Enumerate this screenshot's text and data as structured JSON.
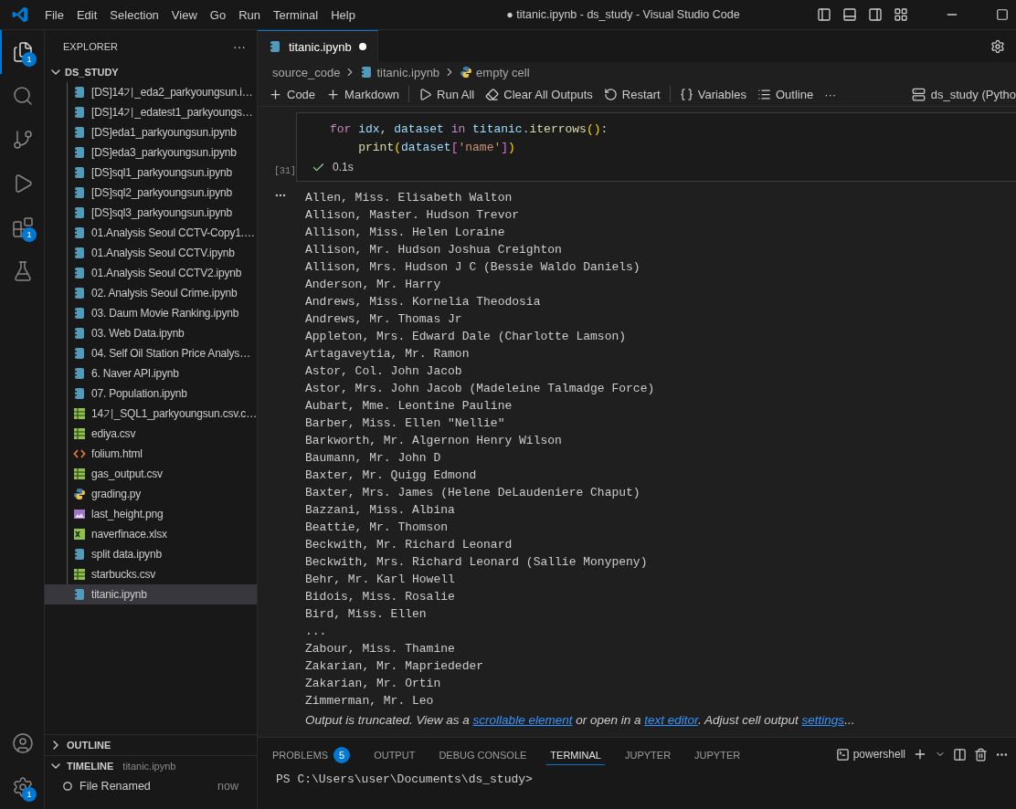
{
  "title_bar": {
    "menus": [
      "File",
      "Edit",
      "Selection",
      "View",
      "Go",
      "Run",
      "Terminal",
      "Help"
    ],
    "title": "● titanic.ipynb - ds_study - Visual Studio Code"
  },
  "activity_bar": {
    "items": [
      {
        "kind": "files",
        "selected": true,
        "badge": "1"
      },
      {
        "kind": "search",
        "selected": false
      },
      {
        "kind": "source-control",
        "selected": false
      },
      {
        "kind": "run",
        "selected": false
      },
      {
        "kind": "extensions",
        "selected": false,
        "badge": "1"
      },
      {
        "kind": "testing",
        "selected": false
      }
    ],
    "bottom": [
      {
        "kind": "account"
      },
      {
        "kind": "manage",
        "badge": "1"
      }
    ]
  },
  "sidebar": {
    "title": "EXPLORER",
    "more": "···",
    "folder": {
      "name": "DS_STUDY",
      "expanded": true
    },
    "files": [
      {
        "name": "[DS]14기_eda2_parkyoungsun.i…",
        "kind": "notebook",
        "selected": false
      },
      {
        "name": "[DS]14기_edatest1_parkyoungs…",
        "kind": "notebook",
        "selected": false
      },
      {
        "name": "[DS]eda1_parkyoungsun.ipynb",
        "kind": "notebook",
        "selected": false
      },
      {
        "name": "[DS]eda3_parkyoungsun.ipynb",
        "kind": "notebook",
        "selected": false
      },
      {
        "name": "[DS]sql1_parkyoungsun.ipynb",
        "kind": "notebook",
        "selected": false
      },
      {
        "name": "[DS]sql2_parkyoungsun.ipynb",
        "kind": "notebook",
        "selected": false
      },
      {
        "name": "[DS]sql3_parkyoungsun.ipynb",
        "kind": "notebook",
        "selected": false
      },
      {
        "name": "01.Analysis Seoul CCTV-Copy1.…",
        "kind": "notebook",
        "selected": false
      },
      {
        "name": "01.Analysis Seoul CCTV.ipynb",
        "kind": "notebook",
        "selected": false
      },
      {
        "name": "01.Analysis Seoul CCTV2.ipynb",
        "kind": "notebook",
        "selected": false
      },
      {
        "name": "02. Analysis Seoul Crime.ipynb",
        "kind": "notebook",
        "selected": false
      },
      {
        "name": "03. Daum Movie Ranking.ipynb",
        "kind": "notebook",
        "selected": false
      },
      {
        "name": "03. Web Data.ipynb",
        "kind": "notebook",
        "selected": false
      },
      {
        "name": "04. Self Oil Station Price Analys…",
        "kind": "notebook",
        "selected": false
      },
      {
        "name": "6. Naver API.ipynb",
        "kind": "notebook",
        "selected": false
      },
      {
        "name": "07. Population.ipynb",
        "kind": "notebook",
        "selected": false
      },
      {
        "name": "14기_SQL1_parkyoungsun.csv.c…",
        "kind": "csv",
        "selected": false
      },
      {
        "name": "ediya.csv",
        "kind": "csv",
        "selected": false
      },
      {
        "name": "folium.html",
        "kind": "html",
        "selected": false
      },
      {
        "name": "gas_output.csv",
        "kind": "csv",
        "selected": false
      },
      {
        "name": "grading.py",
        "kind": "python",
        "selected": false
      },
      {
        "name": "last_height.png",
        "kind": "image",
        "selected": false
      },
      {
        "name": "naverfinace.xlsx",
        "kind": "excel",
        "selected": false
      },
      {
        "name": "split data.ipynb",
        "kind": "notebook",
        "selected": false
      },
      {
        "name": "starbucks.csv",
        "kind": "csv",
        "selected": false
      },
      {
        "name": "titanic.ipynb",
        "kind": "notebook",
        "selected": true
      }
    ],
    "sections": [
      {
        "title": "OUTLINE",
        "expanded": false
      },
      {
        "title": "TIMELINE",
        "subtitle": "titanic.ipynb",
        "expanded": true,
        "entries": [
          {
            "label": "File Renamed",
            "time": "now"
          }
        ]
      }
    ]
  },
  "editor": {
    "tabs": [
      {
        "label": "titanic.ipynb",
        "modified": true,
        "selected": true
      }
    ],
    "breadcrumb": [
      {
        "label": "source_code",
        "kind": "folder"
      },
      {
        "label": "titanic.ipynb",
        "kind": "notebook"
      },
      {
        "label": "empty cell",
        "kind": "python"
      }
    ],
    "toolbar": [
      {
        "label": "Code",
        "kind": "plus"
      },
      {
        "label": "Markdown",
        "kind": "plus"
      },
      {
        "label": "Run All",
        "kind": "run"
      },
      {
        "label": "Clear All Outputs",
        "kind": "clear"
      },
      {
        "label": "Restart",
        "kind": "restart"
      },
      {
        "label": "Variables",
        "kind": "variables"
      },
      {
        "label": "Outline",
        "kind": "outline"
      },
      {
        "label": "···",
        "kind": "more"
      }
    ],
    "kernel": "ds_study (Pytho",
    "cell": {
      "execution_count": "[31]",
      "succeeded": true,
      "duration": "0.1s",
      "code": [
        [
          {
            "text": "for ",
            "kind": "keyword"
          },
          {
            "text": "idx",
            "kind": "variable"
          },
          {
            "text": ", ",
            "kind": "plain"
          },
          {
            "text": "dataset ",
            "kind": "variable"
          },
          {
            "text": "in ",
            "kind": "keyword"
          },
          {
            "text": "titanic",
            "kind": "variable"
          },
          {
            "text": ".",
            "kind": "plain"
          },
          {
            "text": "iterrows",
            "kind": "function"
          },
          {
            "text": "()",
            "kind": "bracket"
          },
          {
            "text": ":",
            "kind": "plain"
          }
        ],
        [
          {
            "text": "    print",
            "kind": "function"
          },
          {
            "text": "(",
            "kind": "bracket"
          },
          {
            "text": "dataset",
            "kind": "variable"
          },
          {
            "text": "[",
            "kind": "bracket2"
          },
          {
            "text": "'name'",
            "kind": "string"
          },
          {
            "text": "]",
            "kind": "bracket2"
          },
          {
            "text": ")",
            "kind": "bracket"
          }
        ]
      ],
      "output": [
        "Allen, Miss. Elisabeth Walton",
        "Allison, Master. Hudson Trevor",
        "Allison, Miss. Helen Loraine",
        "Allison, Mr. Hudson Joshua Creighton",
        "Allison, Mrs. Hudson J C (Bessie Waldo Daniels)",
        "Anderson, Mr. Harry",
        "Andrews, Miss. Kornelia Theodosia",
        "Andrews, Mr. Thomas Jr",
        "Appleton, Mrs. Edward Dale (Charlotte Lamson)",
        "Artagaveytia, Mr. Ramon",
        "Astor, Col. John Jacob",
        "Astor, Mrs. John Jacob (Madeleine Talmadge Force)",
        "Aubart, Mme. Leontine Pauline",
        "Barber, Miss. Ellen \"Nellie\"",
        "Barkworth, Mr. Algernon Henry Wilson",
        "Baumann, Mr. John D",
        "Baxter, Mr. Quigg Edmond",
        "Baxter, Mrs. James (Helene DeLaudeniere Chaput)",
        "Bazzani, Miss. Albina",
        "Beattie, Mr. Thomson",
        "Beckwith, Mr. Richard Leonard",
        "Beckwith, Mrs. Richard Leonard (Sallie Monypeny)",
        "Behr, Mr. Karl Howell",
        "Bidois, Miss. Rosalie",
        "Bird, Miss. Ellen",
        "...",
        "Zabour, Miss. Thamine",
        "Zakarian, Mr. Mapriededer",
        "Zakarian, Mr. Ortin",
        "Zimmerman, Mr. Leo"
      ],
      "truncation": [
        {
          "text": "Output is truncated. View as a ",
          "kind": "text"
        },
        {
          "text": "scrollable element",
          "kind": "link"
        },
        {
          "text": " or open in a ",
          "kind": "text"
        },
        {
          "text": "text editor",
          "kind": "link"
        },
        {
          "text": ". Adjust cell output ",
          "kind": "text"
        },
        {
          "text": "settings",
          "kind": "link"
        },
        {
          "text": "...",
          "kind": "text"
        }
      ]
    }
  },
  "panel": {
    "tabs": [
      {
        "label": "PROBLEMS",
        "badge": "5",
        "selected": false
      },
      {
        "label": "OUTPUT",
        "selected": false
      },
      {
        "label": "DEBUG CONSOLE",
        "selected": false
      },
      {
        "label": "TERMINAL",
        "selected": true
      },
      {
        "label": "JUPYTER",
        "selected": false
      },
      {
        "label": "JUPYTER",
        "selected": false
      }
    ],
    "shell": "powershell",
    "terminal_lines": [
      "PS C:\\Users\\user\\Documents\\ds_study>"
    ]
  }
}
